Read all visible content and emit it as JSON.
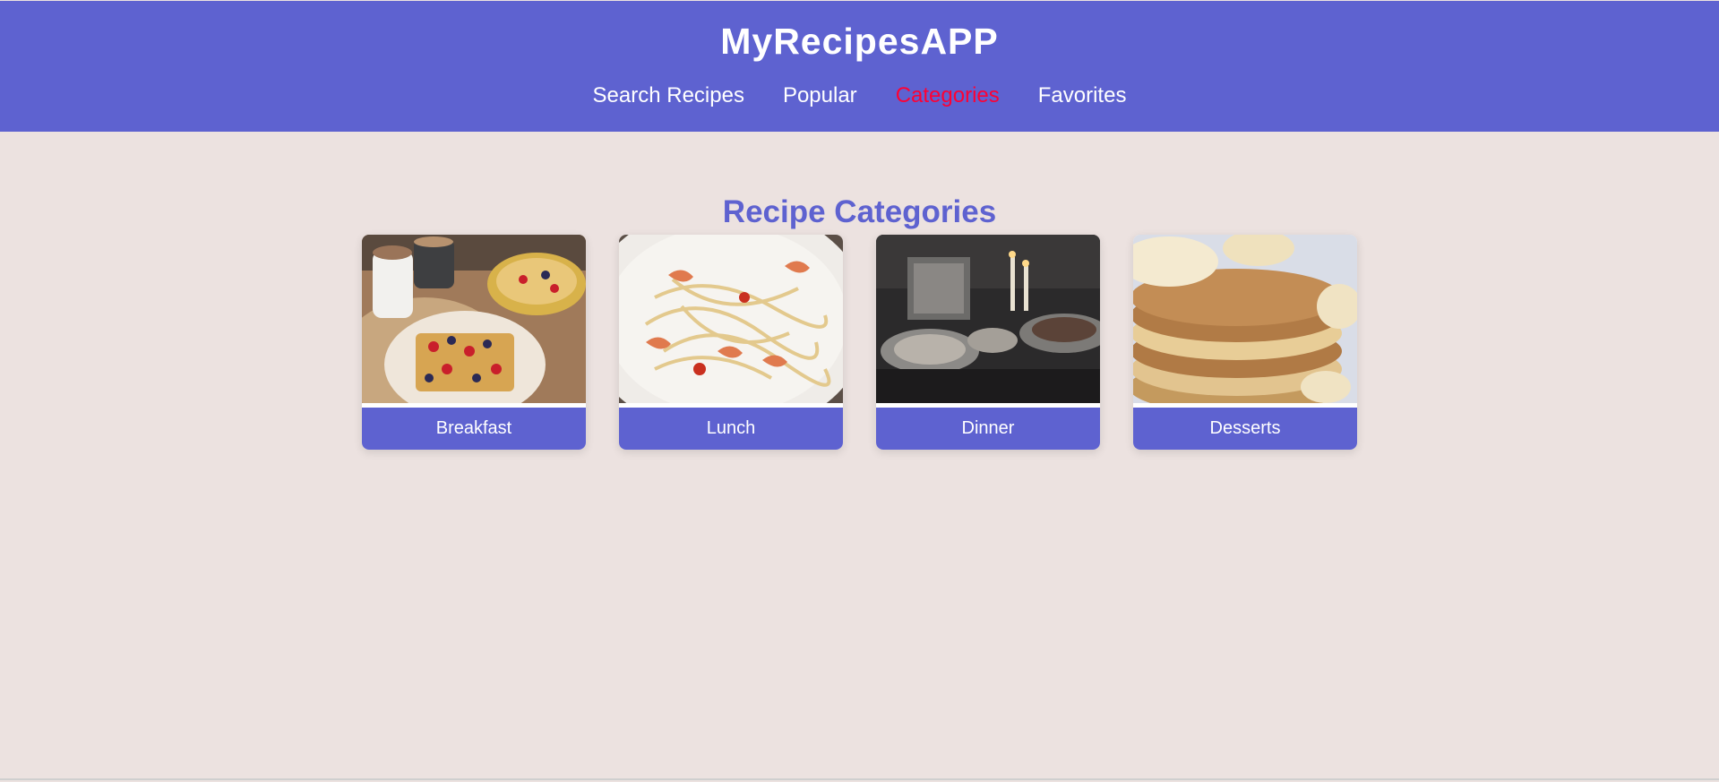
{
  "app": {
    "title": "MyRecipesAPP"
  },
  "nav": {
    "items": [
      {
        "label": "Search Recipes",
        "active": false
      },
      {
        "label": "Popular",
        "active": false
      },
      {
        "label": "Categories",
        "active": true
      },
      {
        "label": "Favorites",
        "active": false
      }
    ]
  },
  "main": {
    "heading": "Recipe Categories"
  },
  "categories": [
    {
      "label": "Breakfast",
      "image": "waffles-with-berries-photo"
    },
    {
      "label": "Lunch",
      "image": "shrimp-spaghetti-photo"
    },
    {
      "label": "Dinner",
      "image": "candlelit-dinner-table-photo"
    },
    {
      "label": "Desserts",
      "image": "banana-pancakes-photo"
    }
  ],
  "colors": {
    "brand": "#5e62d0",
    "active_link": "#ff0033",
    "background": "#ece2e0"
  }
}
